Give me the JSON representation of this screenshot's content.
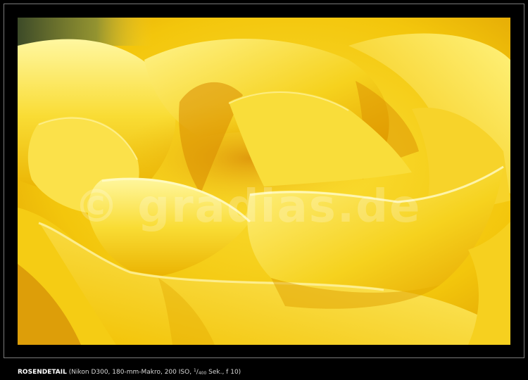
{
  "photo": {
    "subject": "yellow rose petals",
    "colors": {
      "petal_light": "#fff06a",
      "petal_mid": "#f6cf14",
      "petal_deep": "#e39e00",
      "shadow": "#c97800",
      "background_dark": "#4f5a2c"
    },
    "watermark": "© gradias.de"
  },
  "caption": {
    "title": "ROSENDETAIL",
    "details_before_fraction": "(Nikon D300, 180-mm-Makro, 200 ISO,",
    "fraction_numerator": "1",
    "fraction_denominator": "400",
    "details_after_fraction": "Sek., f 10)"
  }
}
